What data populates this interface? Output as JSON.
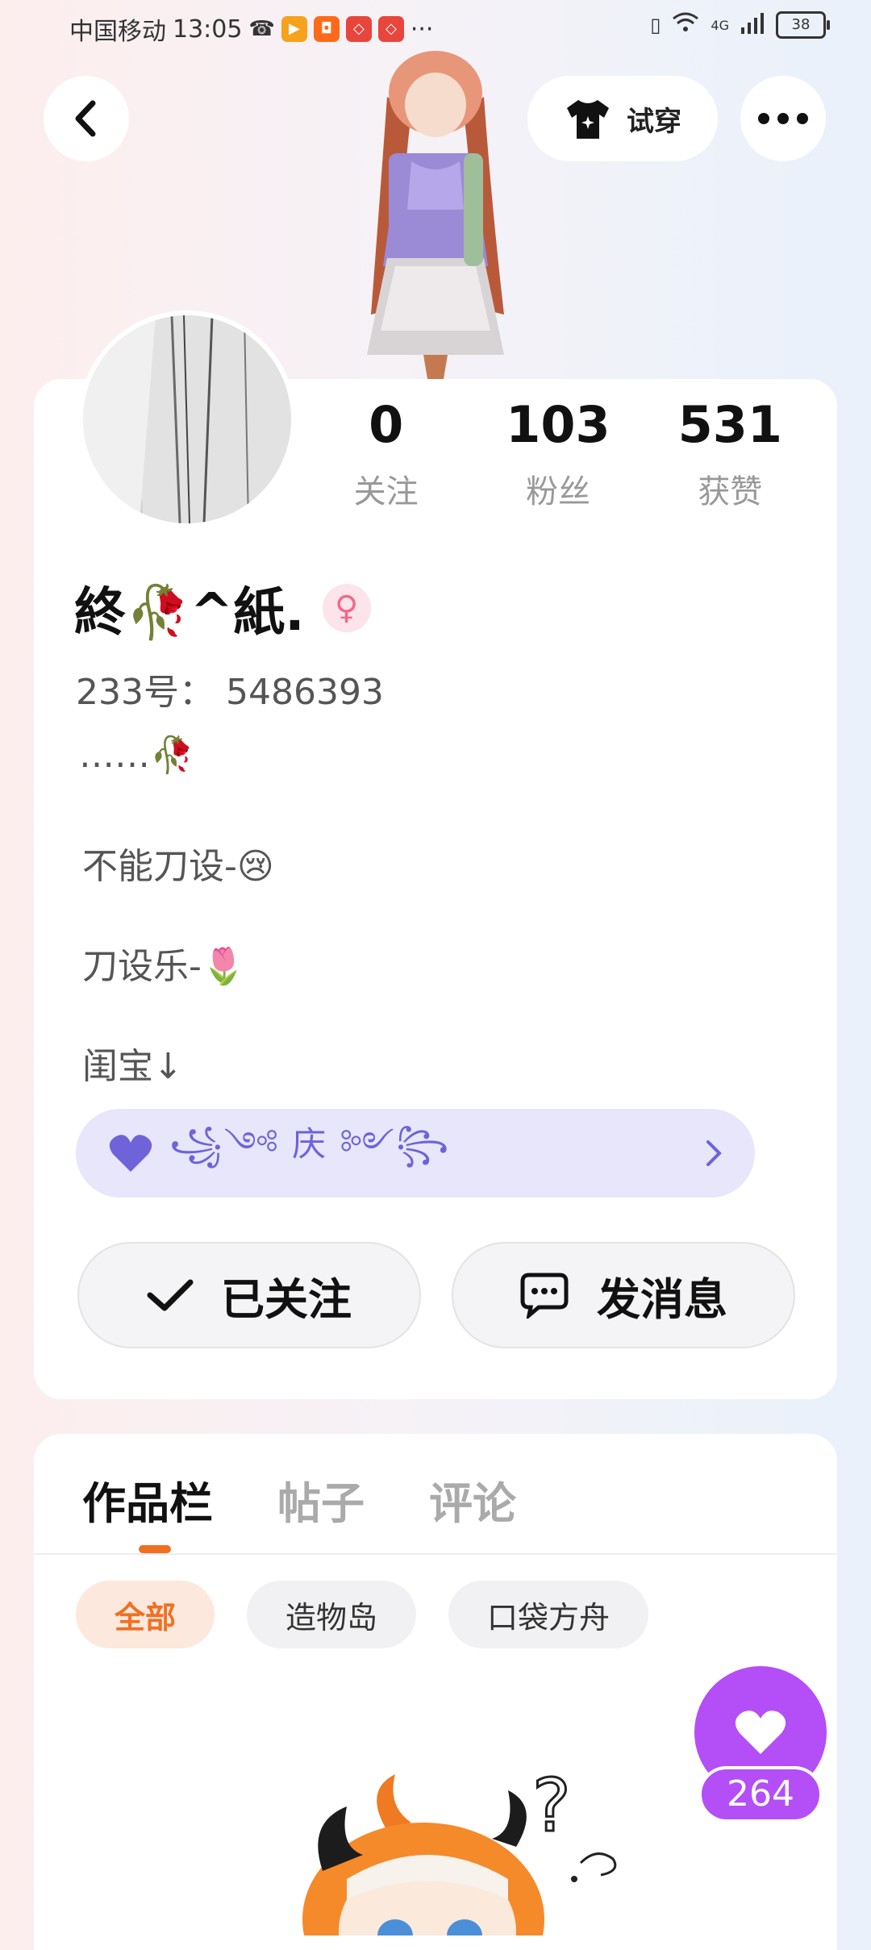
{
  "status_bar": {
    "carrier": "中国移动",
    "time": "13:05",
    "signal_label": "4G",
    "battery": "38"
  },
  "header": {
    "try_on_label": "试穿"
  },
  "profile": {
    "stats": [
      {
        "value": "0",
        "label": "关注"
      },
      {
        "value": "103",
        "label": "粉丝"
      },
      {
        "value": "531",
        "label": "获赞"
      }
    ],
    "nickname": "終🥀^紙.",
    "gender_symbol": "♀",
    "id_line": "233号： 5486393",
    "bio": [
      "……🥀",
      "不能刀设-😢",
      "刀设乐-🌷",
      "闺宝↓"
    ],
    "banner_text": "꧁༺ 庆 ༻꧂",
    "follow_label": "已关注",
    "message_label": "发消息"
  },
  "works": {
    "tabs": [
      "作品栏",
      "帖子",
      "评论"
    ],
    "chips": [
      "全部",
      "造物岛",
      "口袋方舟"
    ],
    "like_count": "264"
  },
  "colors": {
    "accent_orange": "#f07022",
    "fab_purple": "#b44ef7",
    "banner_bg": "#e7e6fb"
  }
}
